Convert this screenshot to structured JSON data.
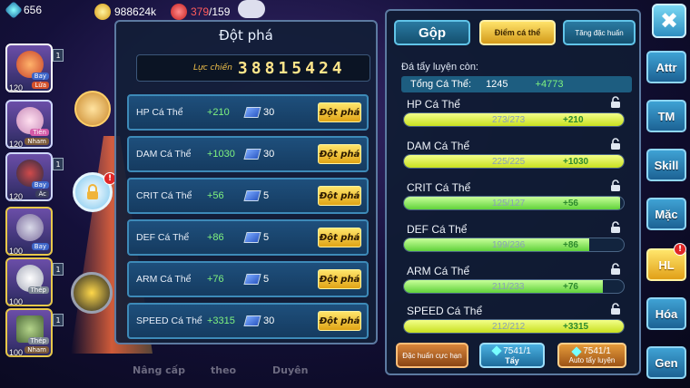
{
  "topbar": {
    "gems": "656",
    "gold": "988624k",
    "energy_current": "379",
    "energy_max": "/159"
  },
  "monsters": [
    {
      "level": "120",
      "types": [
        "Bay",
        "Lửa"
      ]
    },
    {
      "level": "120",
      "types": [
        "Tiên",
        "Nham"
      ]
    },
    {
      "level": "120",
      "types": [
        "Bay",
        "Ác"
      ]
    },
    {
      "level": "100",
      "types": [
        "Bay"
      ]
    },
    {
      "level": "100",
      "types": [
        "Thép"
      ]
    },
    {
      "level": "100",
      "types": [
        "Thép",
        "Nham"
      ]
    }
  ],
  "background_tabs": [
    "Nâng cấp",
    "theo",
    "Duyên"
  ],
  "breakthrough": {
    "title": "Đột phá",
    "power_label": "Lực chiến",
    "power_value": "38815424",
    "rows": [
      {
        "stat": "HP Cá Thể",
        "bonus": "+210",
        "cost": "30",
        "button": "Đột phá"
      },
      {
        "stat": "DAM Cá Thể",
        "bonus": "+1030",
        "cost": "30",
        "button": "Đột phá"
      },
      {
        "stat": "CRIT Cá Thể",
        "bonus": "+56",
        "cost": "5",
        "button": "Đột phá"
      },
      {
        "stat": "DEF Cá Thể",
        "bonus": "+86",
        "cost": "5",
        "button": "Đột phá"
      },
      {
        "stat": "ARM Cá Thể",
        "bonus": "+76",
        "cost": "5",
        "button": "Đột phá"
      },
      {
        "stat": "SPEED Cá Thể",
        "bonus": "+3315",
        "cost": "30",
        "button": "Đột phá"
      }
    ]
  },
  "individual": {
    "tabs": [
      "Gộp",
      "Điểm cá thể",
      "Tăng đặc huấn"
    ],
    "active_tab": "Điểm cá thể",
    "remaining_label": "Đá tẩy luyện còn:",
    "total_label": "Tổng Cá Thể:",
    "total_value": "1245",
    "total_bonus": "+4773",
    "stats": [
      {
        "name": "HP Cá Thể",
        "value": "273/273",
        "bonus": "+210",
        "fill": 1.0
      },
      {
        "name": "DAM Cá Thể",
        "value": "225/225",
        "bonus": "+1030",
        "fill": 1.0
      },
      {
        "name": "CRIT Cá Thể",
        "value": "125/127",
        "bonus": "+56",
        "fill": 0.984
      },
      {
        "name": "DEF Cá Thể",
        "value": "199/236",
        "bonus": "+86",
        "fill": 0.843
      },
      {
        "name": "ARM Cá Thể",
        "value": "211/233",
        "bonus": "+76",
        "fill": 0.906
      },
      {
        "name": "SPEED Cá Thể",
        "value": "212/212",
        "bonus": "+3315",
        "fill": 1.0
      }
    ],
    "bottom_buttons": {
      "special_training": "Đặc huấn cực hạn",
      "stones": "7541/1",
      "wash": "Tẩy",
      "auto_stones": "7541/1",
      "auto_wash": "Auto tẩy luyện"
    }
  },
  "nav": {
    "close": "✖",
    "items": [
      "Attr",
      "TM",
      "Skill",
      "Mặc",
      "HL",
      "Hóa",
      "Gen"
    ],
    "selected": "HL",
    "badge": "!"
  },
  "colors": {
    "panel": "#12203a",
    "gold_button": "#e8b426",
    "bonus_green": "#7ff27f",
    "bar_yellow": "#d6ea3a",
    "bar_green": "#6bd83e"
  }
}
